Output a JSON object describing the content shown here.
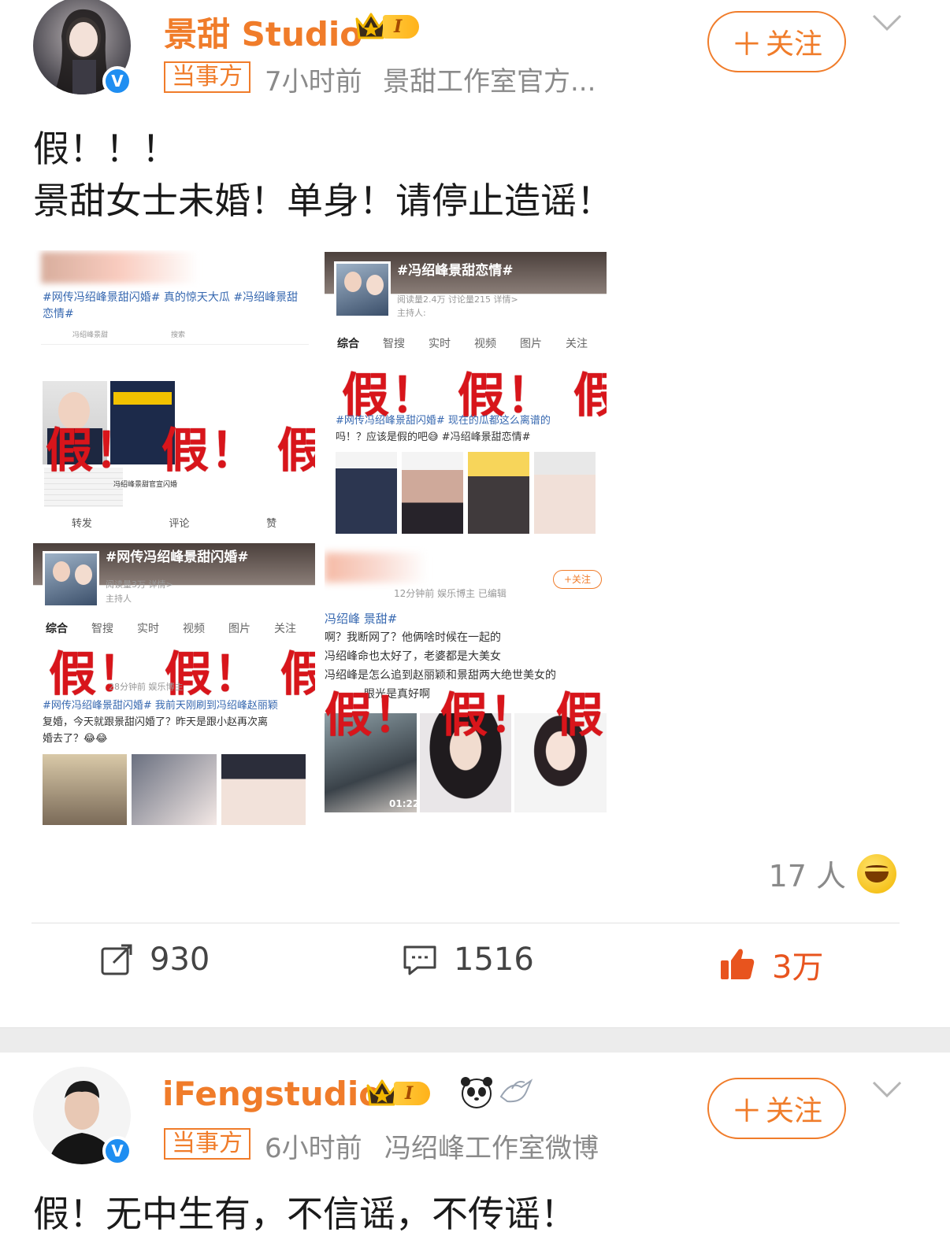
{
  "post1": {
    "username": "景甜 Studio",
    "level": "I",
    "role_tag": "当事方",
    "time": "7小时前",
    "source": "景甜工作室官方...",
    "follow_label": "关注",
    "content_lines": [
      "假！！！",
      "景甜女士未婚！单身！请停止造谣！"
    ],
    "images": [
      {
        "hashtag_line1": "#网传冯绍峰景甜闪婚# 真的惊天大瓜 #冯绍峰景甜",
        "hashtag_line2": "恋情#",
        "fake_text": "假！ 假！ 假！",
        "search_text": "冯绍峰景甜",
        "search_btn": "搜索",
        "caption": "冯绍峰景甜官宣闪婚",
        "actions": [
          "转发",
          "评论",
          "赞"
        ]
      },
      {
        "topic_title": "#冯绍峰景甜恋情#",
        "stats": "阅读量2.4万  讨论量215  详情>",
        "host": "主持人:",
        "tabs": [
          "综合",
          "智搜",
          "实时",
          "视频",
          "图片",
          "关注",
          "+"
        ],
        "fake_text": "假！ 假！ 假！",
        "post_text_line1": "#网传冯绍峰景甜闪婚# 现在的瓜都这么离谱的",
        "post_text_line2": "吗！？应该是假的吧😅 #冯绍峰景甜恋情#"
      },
      {
        "topic_title": "#网传冯绍峰景甜闪婚#",
        "stats": "阅读量3万  详情>",
        "host": "主持人",
        "tabs": [
          "综合",
          "智搜",
          "实时",
          "视频",
          "图片",
          "关注",
          "+"
        ],
        "fake_text": "假！ 假！ 假！",
        "time_line": "28分钟前  娱乐博主",
        "post_text_line1": "#网传冯绍峰景甜闪婚# 我前天刚刷到冯绍峰赵丽颖",
        "post_text_line2": "复婚，今天就跟景甜闪婚了？昨天是跟小赵再次离",
        "post_text_line3": "婚去了？😂😂"
      },
      {
        "follow_label": "+关注",
        "time_line": "12分钟前  娱乐博主  已编辑",
        "hashtag": "冯绍峰 景甜#",
        "post_text_line1": "啊？我断网了？他俩啥时候在一起的",
        "post_text_line2": "冯绍峰命也太好了，老婆都是大美女",
        "post_text_line3": "冯绍峰是怎么追到赵丽颖和景甜两大绝世美女的",
        "post_text_line4": "眼光是真好啊",
        "fake_text": "假！ 假！ 假",
        "video_time": "01:22"
      }
    ],
    "reaction_count": "17 人",
    "reposts": "930",
    "comments": "1516",
    "likes": "3万"
  },
  "post2": {
    "username": "iFengstudio",
    "level": "I",
    "role_tag": "当事方",
    "time": "6小时前",
    "source": "冯绍峰工作室微博",
    "follow_label": "关注",
    "content": "假！无中生有，不信谣，不传谣！"
  },
  "colors": {
    "brand_orange": "#f07c2a",
    "verify_blue": "#1f8ef1",
    "fake_red": "#d8151b",
    "like_orange": "#e8541e"
  }
}
